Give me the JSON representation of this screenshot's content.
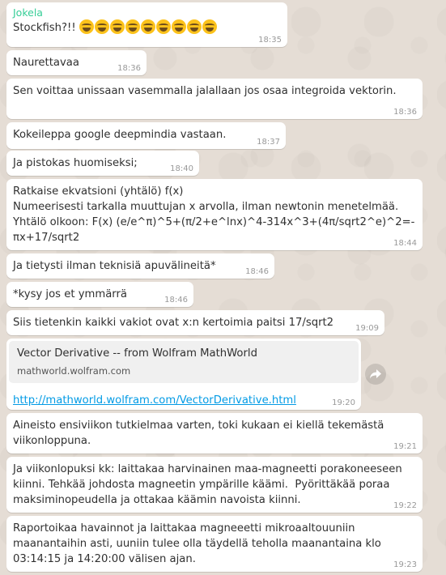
{
  "messages": [
    {
      "sender": "Jokela",
      "text": "Stockfish?!! ",
      "emoji": "😂😂😂😂😂😂😂😂😂",
      "time": "18:35"
    },
    {
      "text": "Naurettavaa",
      "time": "18:36"
    },
    {
      "text": "Sen voittaa unissaan vasemmalla jalallaan jos osaa integroida vektorin.",
      "time": "18:36"
    },
    {
      "text": "Kokeileppa google deepmindia vastaan.",
      "time": "18:37"
    },
    {
      "text": "Ja pistokas huomiseksi;",
      "time": "18:40"
    },
    {
      "text": "Ratkaise ekvatsioni (yhtälö) f(x)\nNumeerisesti tarkalla muuttujan x arvolla, ilman newtonin menetelmää.\nYhtälö olkoon: F(x) (e/e^π)^5+(π/2+e^lnx)^4-314x^3+(4π/sqrt2^e)^2=-πx+17/sqrt2",
      "time": "18:44"
    },
    {
      "text": "Ja tietysti ilman teknisiä apuvälineitä*",
      "time": "18:46"
    },
    {
      "text": "*kysy jos et ymmärrä",
      "time": "18:46"
    },
    {
      "text": "Siis tietenkin kaikki vakiot ovat x:n kertoimia paitsi 17/sqrt2",
      "time": "19:09"
    },
    {
      "preview_title": "Vector Derivative -- from Wolfram MathWorld",
      "preview_domain": "mathworld.wolfram.com",
      "link": "http://mathworld.wolfram.com/VectorDerivative.html",
      "time": "19:20"
    },
    {
      "text": "Aineisto ensiviikon tutkielmaa varten, toki kukaan ei kiellä tekemästä viikonloppuna.",
      "time": "19:21"
    },
    {
      "text": "Ja viikonlopuksi kk: laittakaa harvinainen maa-magneetti porakoneeseen kiinni. Tehkää johdosta magneetin ympärille käämi.  Pyörittäkää poraa maksiminopeudella ja ottakaa käämin navoista kiinni.",
      "time": "19:22"
    },
    {
      "text": "Raportoikaa havainnot ja laittakaa magneeetti mikroaaltouuniin maanantaihin asti, uuniin tulee olla täydellä teholla maanantaina klo 03:14:15 ja 14:20:00 välisen ajan.",
      "time": "19:23"
    }
  ],
  "icons": {
    "forward": "forward-share-icon",
    "emoji": "face-with-tears-of-joy-icon"
  },
  "colors": {
    "background": "#e5ddd5",
    "bubble": "#ffffff",
    "sender_name": "#35cd96",
    "link": "#039be5",
    "timestamp": "#999999"
  }
}
